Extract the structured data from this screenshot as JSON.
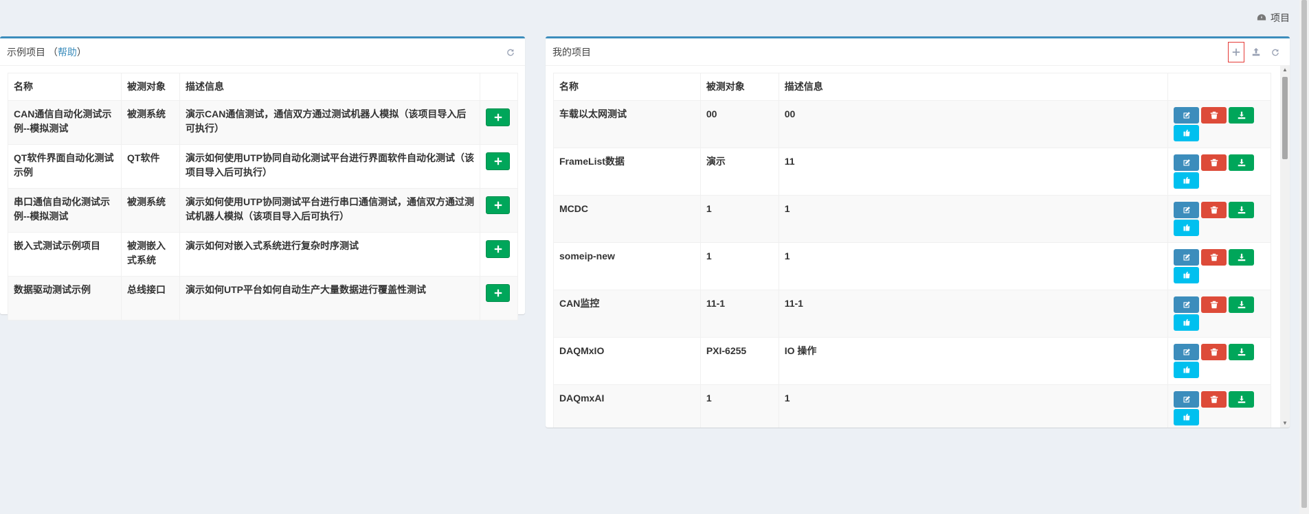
{
  "breadcrumb": {
    "label": "项目"
  },
  "left_panel": {
    "title": "示例项目",
    "help_open": "（",
    "help_link": "帮助",
    "help_close": "）",
    "headers": [
      "名称",
      "被测对象",
      "描述信息"
    ],
    "rows": [
      {
        "name": "CAN通信自动化测试示例--模拟测试",
        "target": "被测系统",
        "desc": "演示CAN通信测试，通信双方通过测试机器人模拟（该项目导入后可执行）"
      },
      {
        "name": "QT软件界面自动化测试示例",
        "target": "QT软件",
        "desc": "演示如何使用UTP协同自动化测试平台进行界面软件自动化测试（该项目导入后可执行）"
      },
      {
        "name": "串口通信自动化测试示例--模拟测试",
        "target": "被测系统",
        "desc": "演示如何使用UTP协同测试平台进行串口通信测试，通信双方通过测试机器人模拟（该项目导入后可执行）"
      },
      {
        "name": "嵌入式测试示例项目",
        "target": "被测嵌入式系统",
        "desc": "演示如何对嵌入式系统进行复杂时序测试"
      },
      {
        "name": "数据驱动测试示例",
        "target": "总线接口",
        "desc": "演示如何UTP平台如何自动生产大量数据进行覆盖性测试"
      }
    ]
  },
  "right_panel": {
    "title": "我的项目",
    "headers": [
      "名称",
      "被测对象",
      "描述信息"
    ],
    "rows": [
      {
        "name": "车载以太网测试",
        "target": "00",
        "desc": "00"
      },
      {
        "name": "FrameList数据",
        "target": "演示",
        "desc": "11"
      },
      {
        "name": "MCDC",
        "target": "1",
        "desc": "1"
      },
      {
        "name": "someip-new",
        "target": "1",
        "desc": "1"
      },
      {
        "name": "CAN监控",
        "target": "11-1",
        "desc": "11-1"
      },
      {
        "name": "DAQMxIO",
        "target": "PXI-6255",
        "desc": "IO 操作"
      },
      {
        "name": "DAQmxAI",
        "target": "1",
        "desc": "1"
      }
    ]
  },
  "colors": {
    "accent": "#3c8dbc",
    "success": "#00a65a",
    "danger": "#dd4b39",
    "info": "#00c0ef",
    "highlight": "#e53935"
  }
}
